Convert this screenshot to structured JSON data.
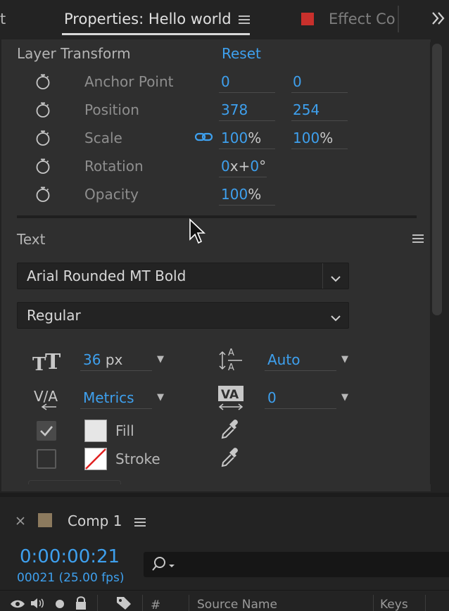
{
  "tabs": {
    "left_fragment": "t",
    "active": "Properties: Hello world",
    "inactive": "Effect Con",
    "inactive_color": "#c8302c",
    "more": "»"
  },
  "transform": {
    "title": "Layer Transform",
    "reset": "Reset",
    "rows": [
      {
        "label": "Anchor Point",
        "v1": "0",
        "v2": "0"
      },
      {
        "label": "Position",
        "v1": "378",
        "v2": "254"
      },
      {
        "label": "Scale",
        "v1": "100",
        "v1_unit": "%",
        "v2": "100",
        "v2_unit": "%"
      },
      {
        "label": "Rotation",
        "v1_a": "0",
        "v1_x": "x+",
        "v1_b": "0",
        "v1_deg": "°"
      },
      {
        "label": "Opacity",
        "v1": "100",
        "v1_unit": "%"
      }
    ]
  },
  "text": {
    "title": "Text",
    "font": "Arial Rounded MT Bold",
    "style": "Regular",
    "size_value": "36",
    "size_unit": "px",
    "leading": "Auto",
    "kerning": "Metrics",
    "tracking": "0",
    "fill_label": "Fill",
    "stroke_label": "Stroke",
    "fill_color": "#e6e6e6",
    "fill_checked": true,
    "stroke_checked": false
  },
  "timeline": {
    "comp_name": "Comp 1",
    "comp_color": "#8c7a5e",
    "timecode": "0:00:00:21",
    "frames": "00021 (25.00 fps)",
    "col_hash": "#",
    "col_source": "Source Name",
    "col_keys": "Keys"
  },
  "colors": {
    "accent": "#3ea0ee",
    "panel": "#2f2f2f",
    "background": "#232323"
  }
}
